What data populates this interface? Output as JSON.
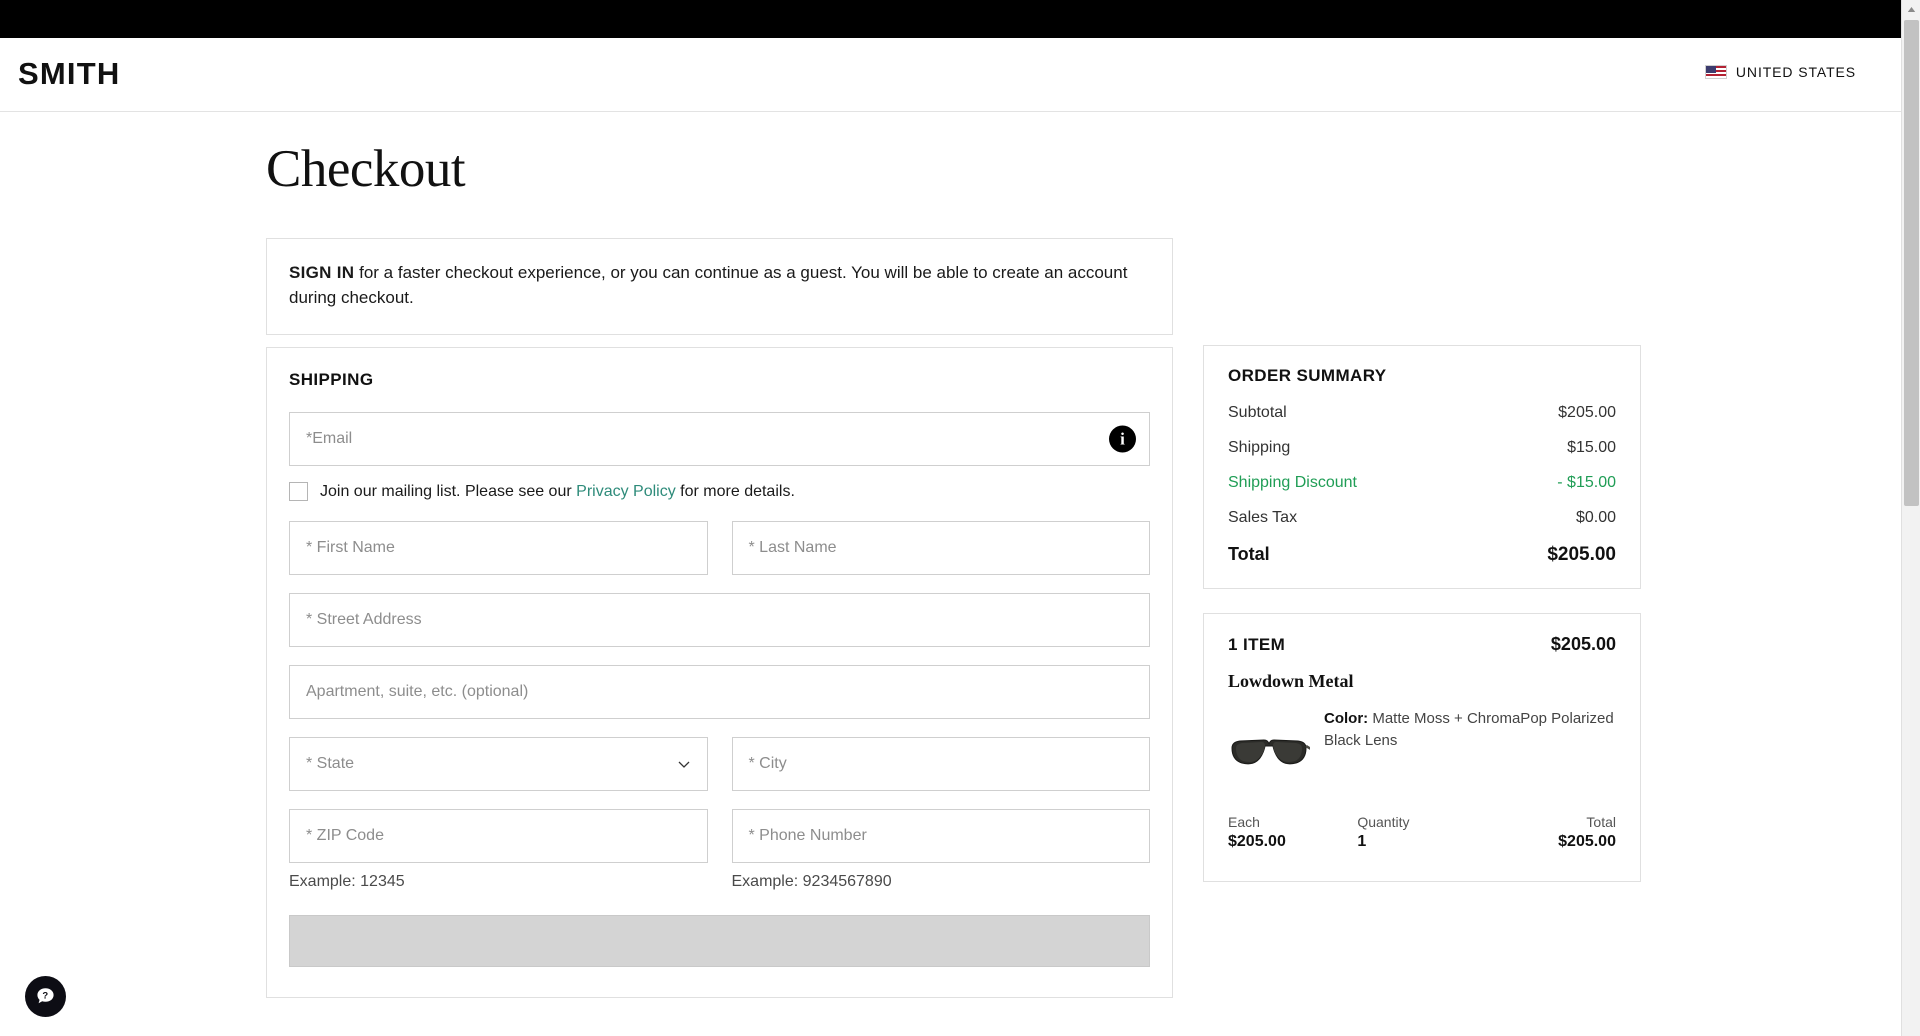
{
  "header": {
    "logo": "SMITH",
    "country": "UNITED STATES",
    "flag_icon": "us-flag-icon"
  },
  "page": {
    "title": "Checkout"
  },
  "signin": {
    "strong": "SIGN IN",
    "rest": " for a faster checkout experience, or you can continue as a guest. You will be able to create an account during checkout."
  },
  "shipping": {
    "section_title": "SHIPPING",
    "email_placeholder": "*Email",
    "info_icon": "info-icon",
    "mailing": {
      "before": "Join our mailing list. Please see our",
      "link": "Privacy Policy",
      "after": "for more details."
    },
    "first_name_placeholder": "* First Name",
    "last_name_placeholder": "* Last Name",
    "street_placeholder": "* Street Address",
    "apartment_placeholder": "Apartment, suite, etc. (optional)",
    "state_placeholder": "* State",
    "city_placeholder": "* City",
    "zip_placeholder": "* ZIP Code",
    "phone_placeholder": "* Phone Number",
    "zip_hint": "Example: 12345",
    "phone_hint": "Example: 9234567890"
  },
  "order_summary": {
    "title": "ORDER SUMMARY",
    "rows": [
      {
        "label": "Subtotal",
        "value": "$205.00"
      },
      {
        "label": "Shipping",
        "value": "$15.00"
      },
      {
        "label": "Shipping Discount",
        "value": "- $15.00"
      },
      {
        "label": "Sales Tax",
        "value": "$0.00"
      }
    ],
    "total_label": "Total",
    "total_value": "$205.00",
    "discount_color": "#1f9d55"
  },
  "item": {
    "count_label": "1 ITEM",
    "price": "$205.00",
    "name": "Lowdown Metal",
    "color_label": "Color:",
    "color_value": "Matte Moss + ChromaPop Polarized Black Lens",
    "each_label": "Each",
    "each_value": "$205.00",
    "quantity_label": "Quantity",
    "quantity_value": "1",
    "total_label": "Total",
    "total_value": "$205.00",
    "thumbnail_icon": "sunglasses-thumbnail"
  },
  "help": {
    "icon": "question-mark-help-icon"
  }
}
